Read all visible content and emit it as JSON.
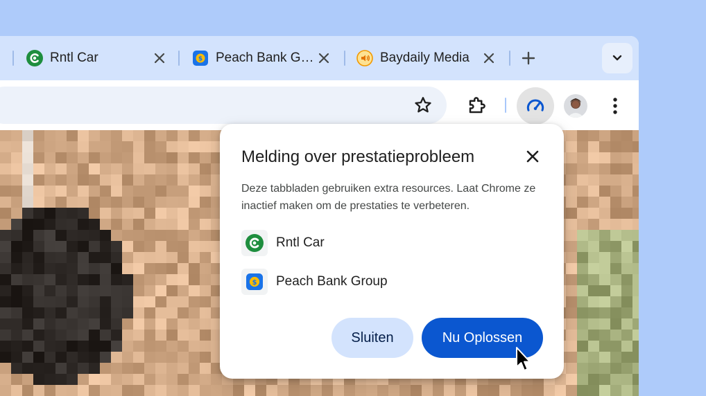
{
  "tabs": [
    {
      "title": "Rntl Car",
      "icon": "rntl-car-favicon"
    },
    {
      "title": "Peach Bank G…",
      "icon": "peach-bank-favicon"
    },
    {
      "title": "Baydaily Media",
      "icon": "baydaily-media-favicon"
    }
  ],
  "toolbar": {
    "icons": [
      "star-icon",
      "extensions-puzzle-icon",
      "performance-gauge-icon",
      "avatar",
      "more-vertical-icon"
    ]
  },
  "dialog": {
    "title": "Melding over prestatieprobleem",
    "body": "Deze tabbladen gebruiken extra resources. Laat Chrome ze inactief maken om de prestaties te verbeteren.",
    "sites": [
      {
        "name": "Rntl Car",
        "icon": "rntl-car-favicon"
      },
      {
        "name": "Peach Bank Group",
        "icon": "peach-bank-favicon"
      }
    ],
    "dismiss_label": "Sluiten",
    "fix_label": "Nu Oplossen"
  },
  "colors": {
    "background": "#aecbfa",
    "tabstrip": "#d3e3fd",
    "accent": "#0b57d0",
    "tonal_button": "#d3e3fd",
    "rntl_green": "#1e8e3e",
    "peach_blue": "#1a73e8",
    "baydaily_orange": "#f29900"
  }
}
